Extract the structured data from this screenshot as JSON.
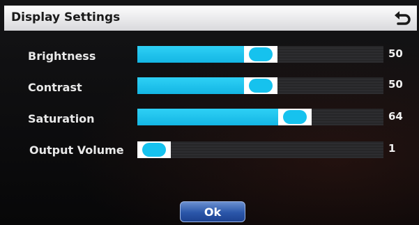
{
  "window": {
    "title": "Display Settings",
    "back_icon": "back-arrow-icon"
  },
  "colors": {
    "accent": "#14b6e4",
    "thumb": "#ffffff",
    "ok_button": "#2a56a9"
  },
  "settings": [
    {
      "label": "Brightness",
      "value": "50",
      "level": 0.5
    },
    {
      "label": "Contrast",
      "value": "50",
      "level": 0.5
    },
    {
      "label": "Saturation",
      "value": "64",
      "level": 0.64
    },
    {
      "label": "Output Volume",
      "value": "1",
      "level": 0.01
    }
  ],
  "footer": {
    "ok_label": "Ok"
  }
}
